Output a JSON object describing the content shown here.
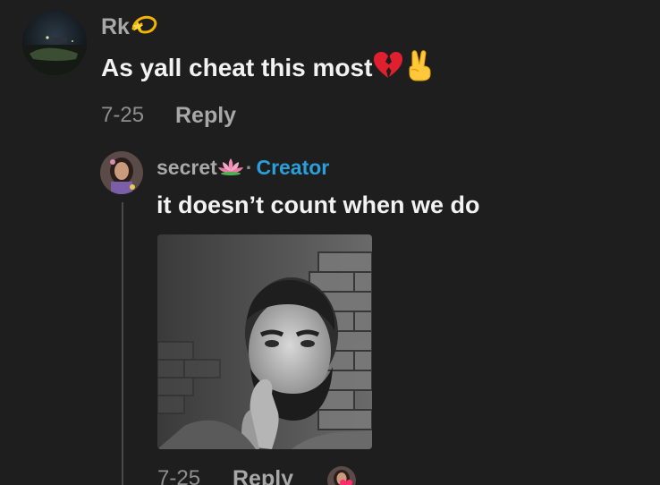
{
  "comment": {
    "username": "Rk",
    "username_emoji": "dizzy-icon",
    "text": "As yall cheat this most",
    "text_emojis": [
      "broken-heart-icon",
      "victory-hand-icon"
    ],
    "date": "7-25",
    "reply_label": "Reply"
  },
  "reply": {
    "username": "secret",
    "username_emoji": "lotus-icon",
    "separator": "·",
    "badge": "Creator",
    "text": "it doesn’t count when we do",
    "date": "7-25",
    "reply_label": "Reply",
    "liked_by_creator": "creator-liked-heart-icon"
  },
  "colors": {
    "background": "#1e1e1e",
    "username": "#a8a8a8",
    "comment_text": "#f2f2f2",
    "meta": "#8e8e8e",
    "creator_badge": "#2b9fd9"
  }
}
